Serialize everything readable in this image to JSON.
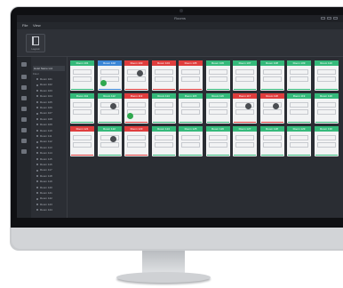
{
  "window": {
    "title": "Rooms"
  },
  "menu": [
    "File",
    "View"
  ],
  "toolbar": {
    "tool_label": "Layout"
  },
  "tree": {
    "header": "Hotel Name Ltd.",
    "subheader": "Floor",
    "rows": [
      "Room 101",
      "Room 102",
      "Room 103",
      "Room 104",
      "Room 105",
      "Room 106",
      "Room 107",
      "Room 108",
      "Room 109",
      "Room 110",
      "Room 111",
      "Room 112",
      "Room 113",
      "Room 114",
      "Room 115",
      "Room 116",
      "Room 117",
      "Room 118",
      "Room 119",
      "Room 120",
      "Room 121",
      "Room 122",
      "Room 123",
      "Room 124"
    ]
  },
  "cards": [
    {
      "label": "Room 101",
      "status": "green",
      "icon": ""
    },
    {
      "label": "Room 102",
      "status": "blue",
      "icon": "check"
    },
    {
      "label": "Room 103",
      "status": "red",
      "icon": "knob"
    },
    {
      "label": "Room 104",
      "status": "red",
      "icon": ""
    },
    {
      "label": "Room 105",
      "status": "red",
      "icon": ""
    },
    {
      "label": "Room 106",
      "status": "green",
      "icon": ""
    },
    {
      "label": "Room 107",
      "status": "green",
      "icon": ""
    },
    {
      "label": "Room 108",
      "status": "green",
      "icon": ""
    },
    {
      "label": "Room 109",
      "status": "green",
      "icon": ""
    },
    {
      "label": "Room 110",
      "status": "green",
      "icon": ""
    },
    {
      "label": "Room 111",
      "status": "green",
      "icon": ""
    },
    {
      "label": "Room 112",
      "status": "green",
      "icon": "knob"
    },
    {
      "label": "Room 113",
      "status": "red",
      "icon": "check"
    },
    {
      "label": "Room 114",
      "status": "green",
      "icon": ""
    },
    {
      "label": "Room 115",
      "status": "green",
      "icon": ""
    },
    {
      "label": "Room 116",
      "status": "green",
      "icon": ""
    },
    {
      "label": "Room 117",
      "status": "red",
      "icon": "knob"
    },
    {
      "label": "Room 118",
      "status": "red",
      "icon": "knob"
    },
    {
      "label": "Room 119",
      "status": "green",
      "icon": ""
    },
    {
      "label": "Room 120",
      "status": "green",
      "icon": ""
    },
    {
      "label": "Room 121",
      "status": "red",
      "icon": ""
    },
    {
      "label": "Room 122",
      "status": "green",
      "icon": "knob"
    },
    {
      "label": "Room 123",
      "status": "red",
      "icon": ""
    },
    {
      "label": "Room 124",
      "status": "green",
      "icon": ""
    },
    {
      "label": "Room 125",
      "status": "green",
      "icon": ""
    },
    {
      "label": "Room 126",
      "status": "green",
      "icon": ""
    },
    {
      "label": "Room 127",
      "status": "green",
      "icon": ""
    },
    {
      "label": "Room 128",
      "status": "green",
      "icon": ""
    },
    {
      "label": "Room 129",
      "status": "green",
      "icon": ""
    },
    {
      "label": "Room 130",
      "status": "green",
      "icon": ""
    }
  ]
}
